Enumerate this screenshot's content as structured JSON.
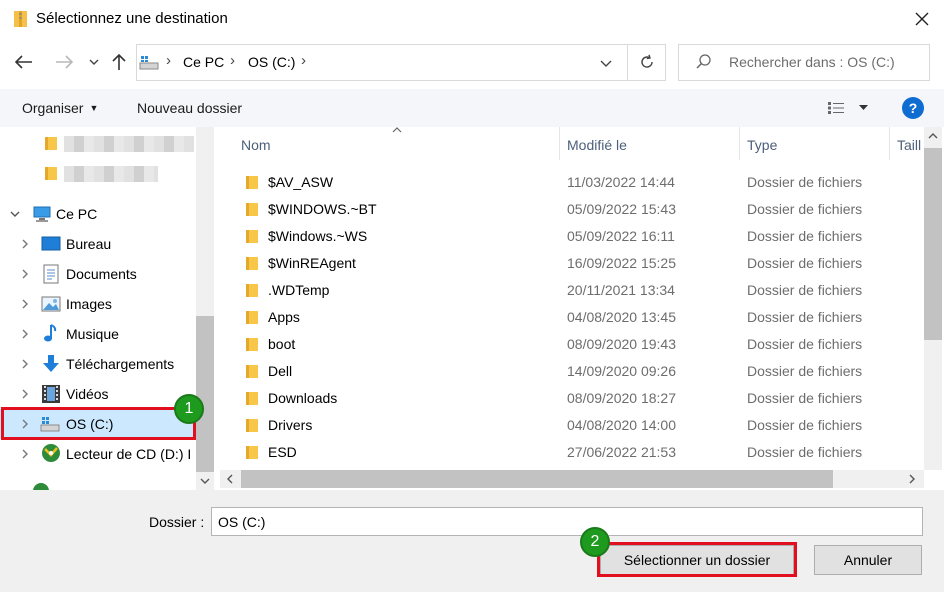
{
  "window": {
    "title": "Sélectionnez une destination",
    "close_glyph": "✕"
  },
  "address": {
    "crumbs": [
      "Ce PC",
      "OS (C:)"
    ],
    "separator": "›",
    "search_placeholder": "Rechercher dans : OS (C:)"
  },
  "toolbar": {
    "organize_label": "Organiser",
    "new_folder_label": "Nouveau dossier",
    "help_label": "?"
  },
  "nav": {
    "this_pc": "Ce PC",
    "items": [
      {
        "label": "Bureau",
        "icon": "desktop-icon"
      },
      {
        "label": "Documents",
        "icon": "documents-icon"
      },
      {
        "label": "Images",
        "icon": "pictures-icon"
      },
      {
        "label": "Musique",
        "icon": "music-icon"
      },
      {
        "label": "Téléchargements",
        "icon": "downloads-icon"
      },
      {
        "label": "Vidéos",
        "icon": "videos-icon"
      },
      {
        "label": "OS (C:)",
        "icon": "drive-c-icon"
      },
      {
        "label": "Lecteur de CD (D:) I",
        "icon": "cd-drive-icon"
      }
    ],
    "selected": "OS (C:)"
  },
  "list": {
    "columns": [
      "Nom",
      "Modifié le",
      "Type",
      "Taill"
    ],
    "rows": [
      {
        "name": "$AV_ASW",
        "date": "11/03/2022 14:44",
        "type": "Dossier de fichiers"
      },
      {
        "name": "$WINDOWS.~BT",
        "date": "05/09/2022 15:43",
        "type": "Dossier de fichiers"
      },
      {
        "name": "$Windows.~WS",
        "date": "05/09/2022 16:11",
        "type": "Dossier de fichiers"
      },
      {
        "name": "$WinREAgent",
        "date": "16/09/2022 15:25",
        "type": "Dossier de fichiers"
      },
      {
        "name": ".WDTemp",
        "date": "20/11/2021 13:34",
        "type": "Dossier de fichiers"
      },
      {
        "name": "Apps",
        "date": "04/08/2020 13:45",
        "type": "Dossier de fichiers"
      },
      {
        "name": "boot",
        "date": "08/09/2020 19:43",
        "type": "Dossier de fichiers"
      },
      {
        "name": "Dell",
        "date": "14/09/2020 09:26",
        "type": "Dossier de fichiers"
      },
      {
        "name": "Downloads",
        "date": "08/09/2020 18:27",
        "type": "Dossier de fichiers"
      },
      {
        "name": "Drivers",
        "date": "04/08/2020 14:00",
        "type": "Dossier de fichiers"
      },
      {
        "name": "ESD",
        "date": "27/06/2022 21:53",
        "type": "Dossier de fichiers"
      }
    ]
  },
  "footer": {
    "folder_label": "Dossier :",
    "folder_value": "OS (C:)",
    "select_button": "Sélectionner un dossier",
    "cancel_button": "Annuler"
  },
  "annotations": {
    "badge1": "1",
    "badge2": "2",
    "highlight_color": "#e2101e",
    "badge_color": "#1e9a1e"
  },
  "colors": {
    "accent": "#0f6cd1",
    "selection": "#cce8ff",
    "folder": "#f8c74a"
  }
}
